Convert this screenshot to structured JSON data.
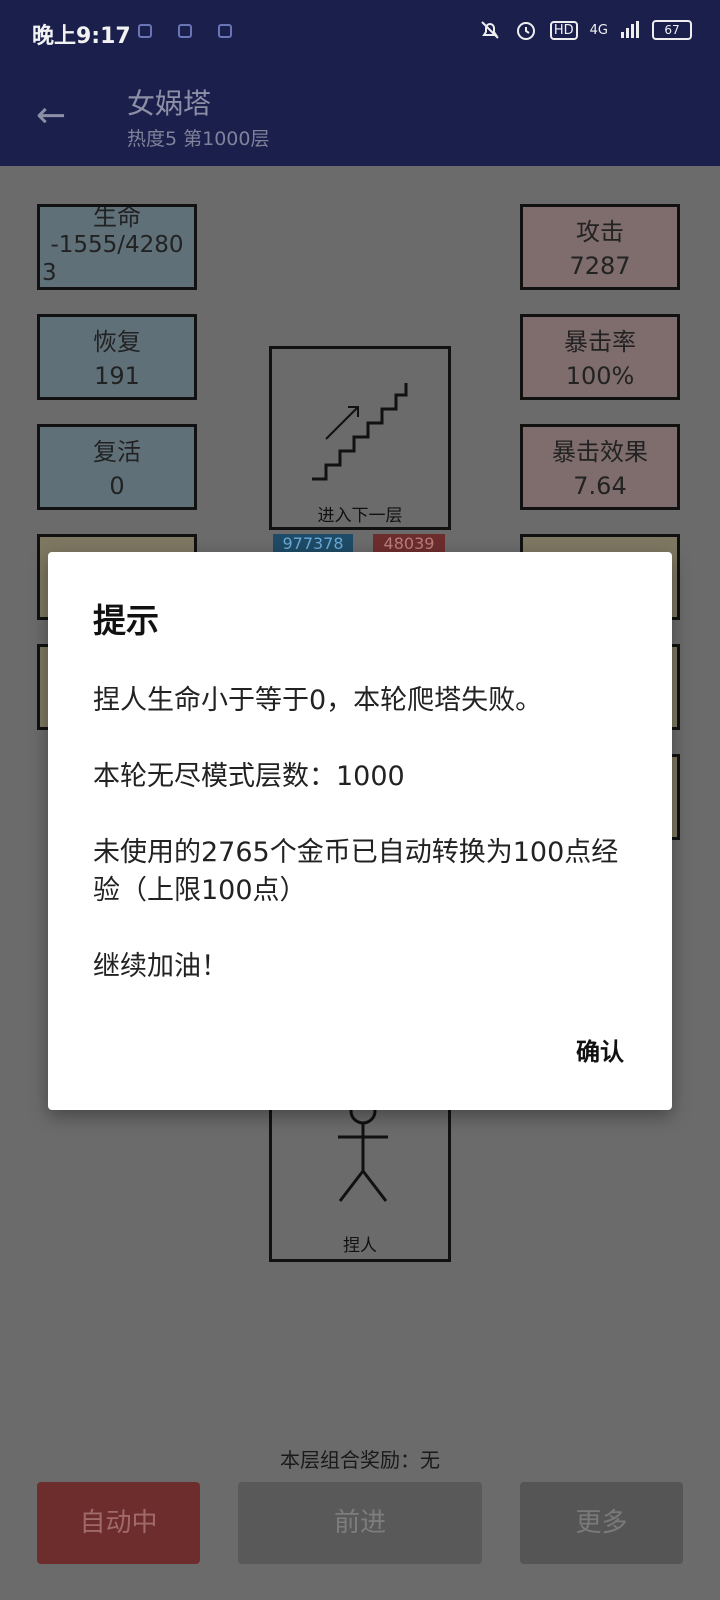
{
  "status": {
    "time": "晚上9:17",
    "hd": "HD",
    "network": "4G",
    "battery": "67"
  },
  "header": {
    "title": "女娲塔",
    "subtitle": "热度5 第1000层"
  },
  "left_stats": [
    {
      "label": "生命",
      "value": "-1555/4280",
      "value2": "3"
    },
    {
      "label": "恢复",
      "value": "191"
    },
    {
      "label": "复活",
      "value": "0"
    }
  ],
  "right_stats": [
    {
      "label": "攻击",
      "value": "7287"
    },
    {
      "label": "暴击率",
      "value": "100%"
    },
    {
      "label": "暴击效果",
      "value": "7.64"
    }
  ],
  "center": {
    "stairs_label": "进入下一层",
    "hp_left": "977378",
    "hp_right": "48039",
    "person_label": "捏人"
  },
  "footer": {
    "combo_text": "本层组合奖励：无",
    "auto_button": "自动中",
    "forward_button": "前进",
    "more_button": "更多"
  },
  "dialog": {
    "title": "提示",
    "line1": "捏人生命小于等于0，本轮爬塔失败。",
    "line2": "本轮无尽模式层数：1000",
    "line3": "未使用的2765个金币已自动转换为100点经验（上限100点）",
    "line4": "继续加油！",
    "confirm": "确认"
  },
  "colors": {
    "header_bg": "#1b1f4c",
    "overlay_bg": "#6b6b6b",
    "auto_button_bg": "#6d2d2d"
  }
}
